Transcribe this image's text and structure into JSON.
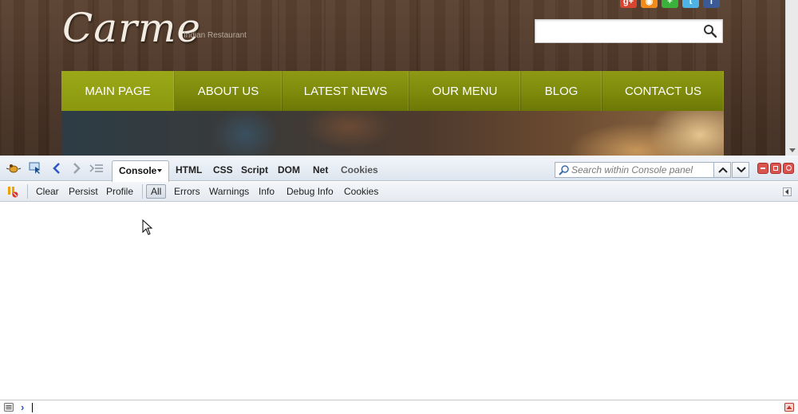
{
  "site": {
    "logo": "Carme",
    "tagline": "Indian Restaurant",
    "social_icons": [
      "google-plus-icon",
      "rss-icon",
      "plus-icon",
      "twitter-icon",
      "facebook-icon"
    ],
    "search": {
      "value": "",
      "placeholder": ""
    },
    "nav": [
      {
        "label": "MAIN PAGE",
        "active": true
      },
      {
        "label": "ABOUT US",
        "active": false
      },
      {
        "label": "LATEST NEWS",
        "active": false
      },
      {
        "label": "OUR MENU",
        "active": false
      },
      {
        "label": "BLOG",
        "active": false
      },
      {
        "label": "CONTACT US",
        "active": false
      }
    ],
    "colors": {
      "nav_green": "#7d8a0b",
      "wood_brown": "#4a3425"
    }
  },
  "firebug": {
    "tabs": {
      "console": "Console",
      "html": "HTML",
      "css": "CSS",
      "script": "Script",
      "dom": "DOM",
      "net": "Net",
      "cookies": "Cookies"
    },
    "search": {
      "placeholder": "Search within Console panel",
      "value": ""
    },
    "subbar": {
      "clear": "Clear",
      "persist": "Persist",
      "profile": "Profile",
      "all": "All",
      "errors": "Errors",
      "warnings": "Warnings",
      "info": "Info",
      "debug_info": "Debug Info",
      "cookies": "Cookies"
    },
    "command_line": {
      "prompt": "›",
      "value": ""
    },
    "colors": {
      "toolbar_bg": "#dde5ef",
      "accent_blue": "#2b55c4",
      "close_red": "#d9534f"
    }
  }
}
